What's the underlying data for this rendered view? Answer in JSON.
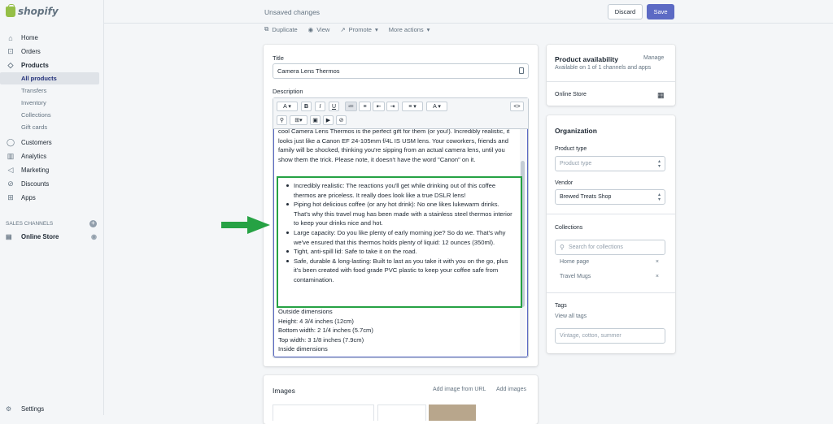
{
  "brand": {
    "name": "shopify",
    "color": "#95bf47"
  },
  "nav": {
    "home": "Home",
    "orders": "Orders",
    "products": "Products",
    "products_sub": [
      "All products",
      "Transfers",
      "Inventory",
      "Collections",
      "Gift cards"
    ],
    "customers": "Customers",
    "analytics": "Analytics",
    "marketing": "Marketing",
    "discounts": "Discounts",
    "apps": "Apps",
    "sales_channels": "SALES CHANNELS",
    "online_store": "Online Store",
    "settings": "Settings"
  },
  "topbar": {
    "status": "Unsaved changes",
    "discard": "Discard",
    "save": "Save"
  },
  "actions": {
    "duplicate": "Duplicate",
    "view": "View",
    "promote": "Promote",
    "more": "More actions"
  },
  "product": {
    "title_label": "Title",
    "title_value": "Camera Lens Thermos",
    "description_label": "Description",
    "intro": "cool Camera Lens Thermos is the perfect gift for them (or you!). Incredibly realistic, it looks just like a Canon EF 24-105mm f/4L IS USM lens. Your coworkers, friends and family will be shocked, thinking you're sipping from an actual camera lens, until you show them the trick. Please note, it doesn't have the word \"Canon\" on it.",
    "bullets": [
      "Incredibly realistic: The reactions you'll get while drinking out of this coffee thermos are priceless. It really does look like a true DSLR lens!",
      "Piping hot delicious coffee (or any hot drink): No one likes lukewarm drinks. That's why this travel mug has been made with a stainless steel thermos interior to keep your drinks nice and hot.",
      "Large capacity: Do you like plenty of early morning joe? So do we. That's why we've ensured that this thermos holds plenty of liquid: 12 ounces (350ml).",
      "Tight, anti-spill lid: Safe to take it on the road.",
      "Safe, durable & long-lasting: Built to last as you take it with you on the go, plus it's been created with food grade PVC plastic to keep your coffee safe from contamination."
    ],
    "dims": [
      "Outside dimensions",
      "Height: 4 3/4 inches (12cm)",
      "Bottom width: 2 1/4 inches (5.7cm)",
      "Top width: 3 1/8 inches (7.9cm)",
      "Inside dimensions"
    ]
  },
  "availability": {
    "title": "Product availability",
    "manage": "Manage",
    "desc": "Available on 1 of 1 channels and apps",
    "channel": "Online Store"
  },
  "organization": {
    "title": "Organization",
    "type_label": "Product type",
    "type_placeholder": "Product type",
    "vendor_label": "Vendor",
    "vendor_value": "Brewed Treats Shop",
    "collections_label": "Collections",
    "collections_placeholder": "Search for collections",
    "collections": [
      "Home page",
      "Travel Mugs"
    ],
    "tags_label": "Tags",
    "view_all": "View all tags",
    "tags_placeholder": "Vintage, cotton, summer"
  },
  "images": {
    "title": "Images",
    "add_url": "Add image from URL",
    "add": "Add images"
  },
  "colors": {
    "accent": "#5c6ac4",
    "highlight": "#26a244"
  }
}
